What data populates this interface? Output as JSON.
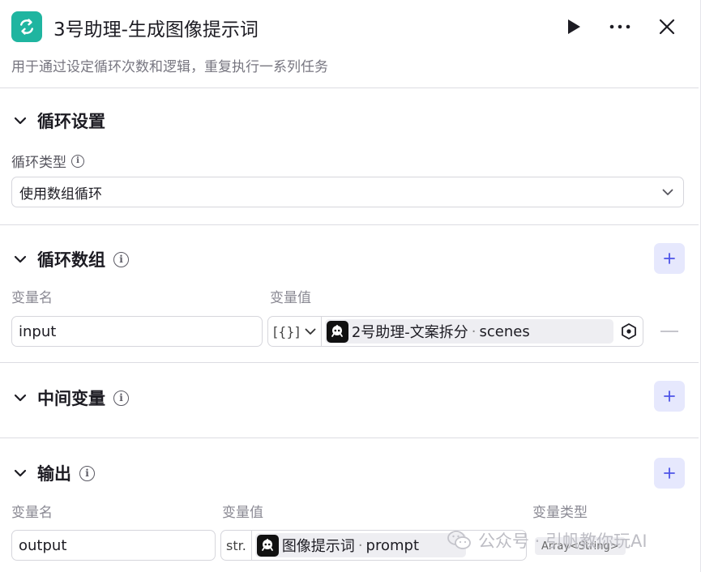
{
  "header": {
    "title": "3号助理-生成图像提示词",
    "description": "用于通过设定循环次数和逻辑，重复执行一系列任务",
    "icons": {
      "app": "loop-icon",
      "run": "play-icon",
      "more": "more-icon",
      "close": "close-icon"
    }
  },
  "loop_settings": {
    "title": "循环设置",
    "type_label": "循环类型",
    "type_value": "使用数组循环"
  },
  "loop_array": {
    "title": "循环数组",
    "col_name": "变量名",
    "col_value": "变量值",
    "row": {
      "name": "input",
      "type_symbol": "[{}]",
      "ref_source": "2号助理-文案拆分",
      "ref_sep": "·",
      "ref_field": "scenes"
    }
  },
  "intermediate": {
    "title": "中间变量"
  },
  "output": {
    "title": "输出",
    "col_name": "变量名",
    "col_value": "变量值",
    "col_type": "变量类型",
    "row": {
      "name": "output",
      "type_symbol": "str.",
      "ref_source": "图像提示词",
      "ref_sep": "·",
      "ref_field": "prompt",
      "var_type": "Array<String>"
    }
  },
  "watermark": {
    "text": "公众号 · 引帆教你玩AI"
  },
  "colors": {
    "accent": "#4d53e8",
    "app_icon": "#1fb5a0",
    "add_button_bg": "#e6e8fd"
  }
}
